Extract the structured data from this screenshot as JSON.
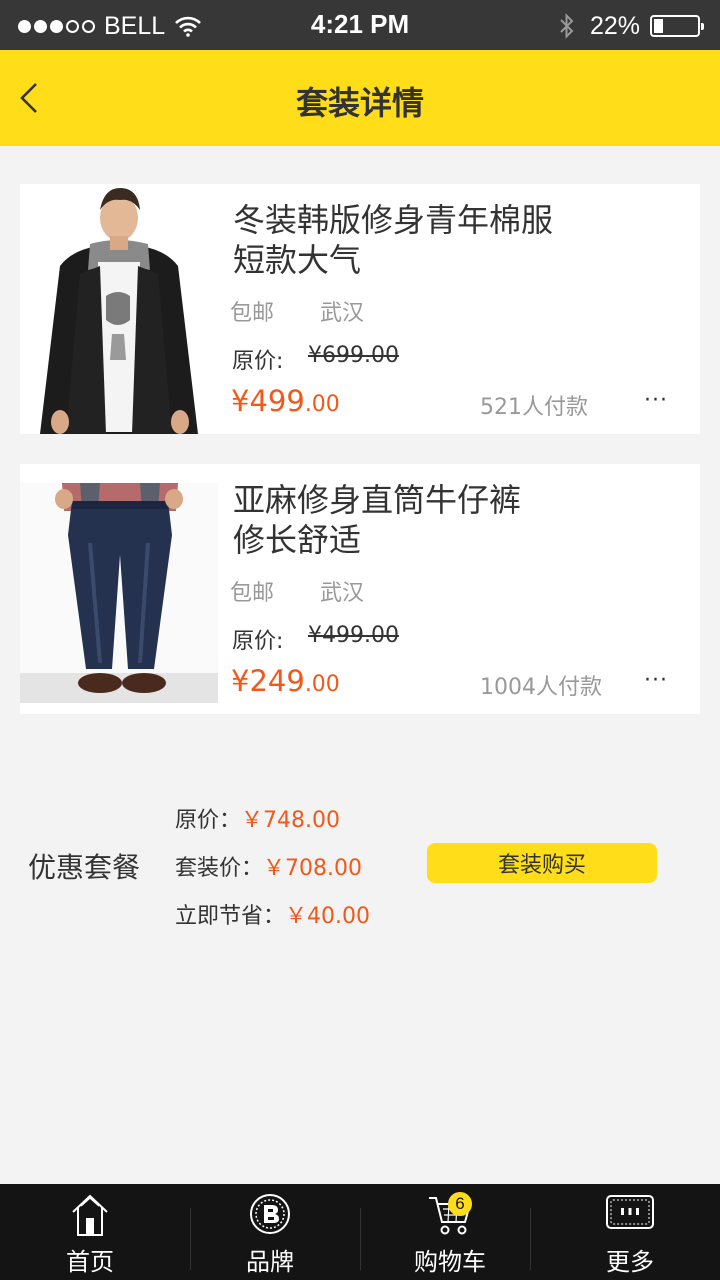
{
  "status_bar": {
    "carrier": "BELL",
    "time": "4:21 PM",
    "battery_percent": "22%",
    "battery_level": 0.22,
    "signal_bars": 3,
    "icons": [
      "signal-dots-icon",
      "wifi-icon",
      "bluetooth-icon",
      "battery-icon"
    ]
  },
  "nav": {
    "title": "套装详情",
    "back_icon": "chevron-left-icon"
  },
  "products": [
    {
      "title_line1": "冬装韩版修身青年棉服",
      "title_line2": "短款大气",
      "shipping": "包邮",
      "city": "武汉",
      "orig_label": "原价:",
      "orig_price": "¥699.00",
      "price_int": "¥499",
      "price_dec": ".00",
      "buyers": "521人付款",
      "more": "···",
      "image": "jacket-model-photo"
    },
    {
      "title_line1": "亚麻修身直筒牛仔裤",
      "title_line2": "修长舒适",
      "shipping": "包邮",
      "city": "武汉",
      "orig_label": "原价:",
      "orig_price": "¥499.00",
      "price_int": "¥249",
      "price_dec": ".00",
      "buyers": "1004人付款",
      "more": "···",
      "image": "jeans-model-photo"
    }
  ],
  "bundle": {
    "label": "优惠套餐",
    "orig_label": "原价：",
    "orig_value": "￥748.00",
    "bundle_label": "套装价：",
    "bundle_value": "￥708.00",
    "save_label": "立即节省：",
    "save_value": "￥40.00",
    "buy_button": "套装购买"
  },
  "tab_bar": {
    "tabs": [
      {
        "label": "首页",
        "icon": "home-icon"
      },
      {
        "label": "品牌",
        "icon": "brand-icon"
      },
      {
        "label": "购物车",
        "icon": "cart-icon",
        "badge": "6"
      },
      {
        "label": "更多",
        "icon": "more-icon"
      }
    ]
  },
  "colors": {
    "accent_yellow": "#ffdd18",
    "price_orange": "#f1591a",
    "status_bar": "#373737",
    "tab_bar": "#141414",
    "background": "#f3f3f3"
  }
}
